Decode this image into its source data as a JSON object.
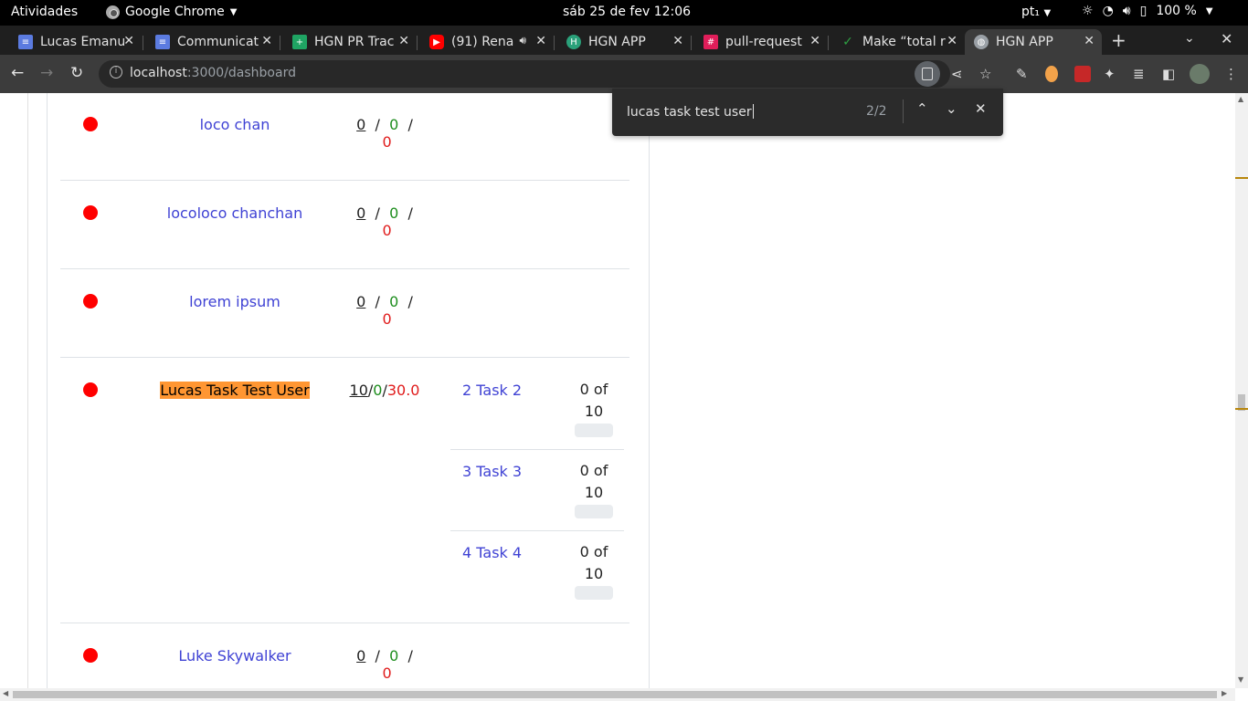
{
  "os": {
    "activities": "Atividades",
    "app_name": "Google Chrome",
    "clock": "sáb 25 de fev  12:06",
    "lang": "pt₁",
    "battery": "100 %"
  },
  "tabs": [
    {
      "title": "Lucas Emanu",
      "favicon": "docs-icon",
      "color": "#5b7be0"
    },
    {
      "title": "Communicat",
      "favicon": "docs-icon",
      "color": "#5b7be0"
    },
    {
      "title": "HGN PR Trac",
      "favicon": "sheets-icon",
      "color": "#1fa463"
    },
    {
      "title": "(91) Rena",
      "favicon": "youtube-icon",
      "color": "#ff0000"
    },
    {
      "title": "HGN APP",
      "favicon": "hgn-icon",
      "color": "#2aa17a"
    },
    {
      "title": "pull-request",
      "favicon": "slack-icon",
      "color": "#e01e5a"
    },
    {
      "title": "Make “total r",
      "favicon": "check-icon",
      "color": "#2ea043"
    },
    {
      "title": "HGN APP",
      "favicon": "globe-icon",
      "color": "#9aa0a6"
    }
  ],
  "address": {
    "host": "localhost",
    "path": ":3000/dashboard"
  },
  "find": {
    "query": "lucas task test user",
    "count": "2/2"
  },
  "users": [
    {
      "name": "loco chan",
      "hours": {
        "a": "0",
        "g": "0",
        "r": "0"
      },
      "tasks": []
    },
    {
      "name": "locoloco chanchan",
      "hours": {
        "a": "0",
        "g": "0",
        "r": "0"
      },
      "tasks": []
    },
    {
      "name": "lorem ipsum",
      "hours": {
        "a": "0",
        "g": "0",
        "r": "0"
      },
      "tasks": []
    },
    {
      "name": "Lucas Task Test User",
      "highlight": true,
      "hours": {
        "a": "10",
        "g": "0",
        "r": "30.0"
      },
      "tasks": [
        {
          "label": "2 Task 2",
          "progress_top": "0 of",
          "progress_bottom": "10"
        },
        {
          "label": "3 Task 3",
          "progress_top": "0 of",
          "progress_bottom": "10"
        },
        {
          "label": "4 Task 4",
          "progress_top": "0 of",
          "progress_bottom": "10"
        }
      ]
    },
    {
      "name": "Luke Skywalker",
      "hours": {
        "a": "0",
        "g": "0",
        "r": "0"
      },
      "tasks": []
    }
  ],
  "colors": {
    "status_dot": "#ff0000",
    "link": "#3f42d4",
    "highlight": "#ff9632"
  }
}
